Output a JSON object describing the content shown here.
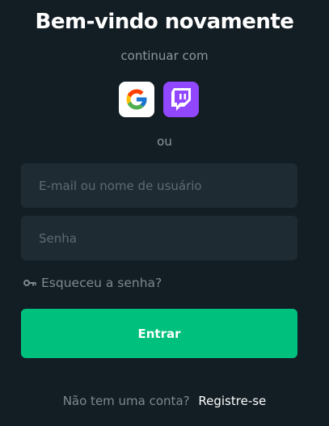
{
  "header": {
    "title": "Bem-vindo novamente",
    "subtitle": "continuar com"
  },
  "social": {
    "providers": [
      {
        "name": "Google",
        "icon": "google-icon",
        "background": "#ffffff"
      },
      {
        "name": "Twitch",
        "icon": "twitch-icon",
        "background": "#9146ff"
      }
    ],
    "divider_text": "ou"
  },
  "form": {
    "email": {
      "placeholder": "E-mail ou nome de usuário",
      "value": ""
    },
    "password": {
      "placeholder": "Senha",
      "value": ""
    },
    "forgot_password": {
      "label": "Esqueceu a senha?",
      "icon": "key-icon"
    },
    "submit_label": "Entrar"
  },
  "footer": {
    "question": "Não tem uma conta?",
    "register_label": "Registre-se"
  },
  "colors": {
    "background": "#131e24",
    "input_background": "#1f2b32",
    "accent": "#00c07d",
    "muted_text": "#8d979d"
  }
}
